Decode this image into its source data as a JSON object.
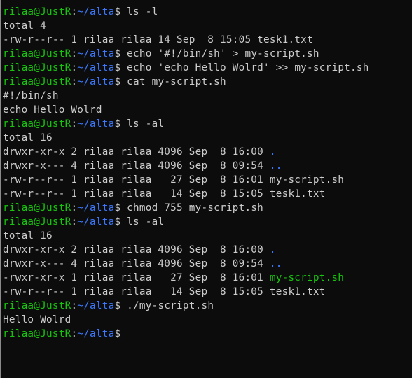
{
  "window": {
    "user_host": "rilaa@JustR",
    "prompt_sep": ":",
    "prompt_path": "~/alta",
    "prompt_symbol": "$"
  },
  "colors": {
    "background": "#0c0c0c",
    "text": "#cccccc",
    "user_host": "#16c60c",
    "path": "#3b78ff",
    "directory": "#3b78ff",
    "executable": "#16c60c"
  },
  "lines": [
    {
      "type": "prompt",
      "cmd": " ls -l"
    },
    {
      "type": "out",
      "segments": [
        {
          "t": "total 4",
          "c": "plain"
        }
      ]
    },
    {
      "type": "out",
      "segments": [
        {
          "t": "-rw-r--r-- 1 rilaa rilaa 14 Sep  8 15:05 tesk1.txt",
          "c": "plain"
        }
      ]
    },
    {
      "type": "prompt",
      "cmd": " echo '#!/bin/sh' > my-script.sh"
    },
    {
      "type": "prompt",
      "cmd": " echo 'echo Hello Wolrd' >> my-script.sh"
    },
    {
      "type": "prompt",
      "cmd": " cat my-script.sh"
    },
    {
      "type": "out",
      "segments": [
        {
          "t": "#!/bin/sh",
          "c": "plain"
        }
      ]
    },
    {
      "type": "out",
      "segments": [
        {
          "t": "echo Hello Wolrd",
          "c": "plain"
        }
      ]
    },
    {
      "type": "prompt",
      "cmd": " ls -al"
    },
    {
      "type": "out",
      "segments": [
        {
          "t": "total 16",
          "c": "plain"
        }
      ]
    },
    {
      "type": "out",
      "segments": [
        {
          "t": "drwxr-xr-x 2 rilaa rilaa 4096 Sep  8 16:00 ",
          "c": "plain"
        },
        {
          "t": ".",
          "c": "dir"
        }
      ]
    },
    {
      "type": "out",
      "segments": [
        {
          "t": "drwxr-x--- 4 rilaa rilaa 4096 Sep  8 09:54 ",
          "c": "plain"
        },
        {
          "t": "..",
          "c": "dir"
        }
      ]
    },
    {
      "type": "out",
      "segments": [
        {
          "t": "-rw-r--r-- 1 rilaa rilaa   27 Sep  8 16:01 my-script.sh",
          "c": "plain"
        }
      ]
    },
    {
      "type": "out",
      "segments": [
        {
          "t": "-rw-r--r-- 1 rilaa rilaa   14 Sep  8 15:05 tesk1.txt",
          "c": "plain"
        }
      ]
    },
    {
      "type": "prompt",
      "cmd": " chmod 755 my-script.sh"
    },
    {
      "type": "prompt",
      "cmd": " ls -al"
    },
    {
      "type": "out",
      "segments": [
        {
          "t": "total 16",
          "c": "plain"
        }
      ]
    },
    {
      "type": "out",
      "segments": [
        {
          "t": "drwxr-xr-x 2 rilaa rilaa 4096 Sep  8 16:00 ",
          "c": "plain"
        },
        {
          "t": ".",
          "c": "dir"
        }
      ]
    },
    {
      "type": "out",
      "segments": [
        {
          "t": "drwxr-x--- 4 rilaa rilaa 4096 Sep  8 09:54 ",
          "c": "plain"
        },
        {
          "t": "..",
          "c": "dir"
        }
      ]
    },
    {
      "type": "out",
      "segments": [
        {
          "t": "-rwxr-xr-x 1 rilaa rilaa   27 Sep  8 16:01 ",
          "c": "plain"
        },
        {
          "t": "my-script.sh",
          "c": "exec"
        }
      ]
    },
    {
      "type": "out",
      "segments": [
        {
          "t": "-rw-r--r-- 1 rilaa rilaa   14 Sep  8 15:05 tesk1.txt",
          "c": "plain"
        }
      ]
    },
    {
      "type": "prompt",
      "cmd": " ./my-script.sh"
    },
    {
      "type": "out",
      "segments": [
        {
          "t": "Hello Wolrd",
          "c": "plain"
        }
      ]
    },
    {
      "type": "prompt",
      "cmd": ""
    }
  ]
}
